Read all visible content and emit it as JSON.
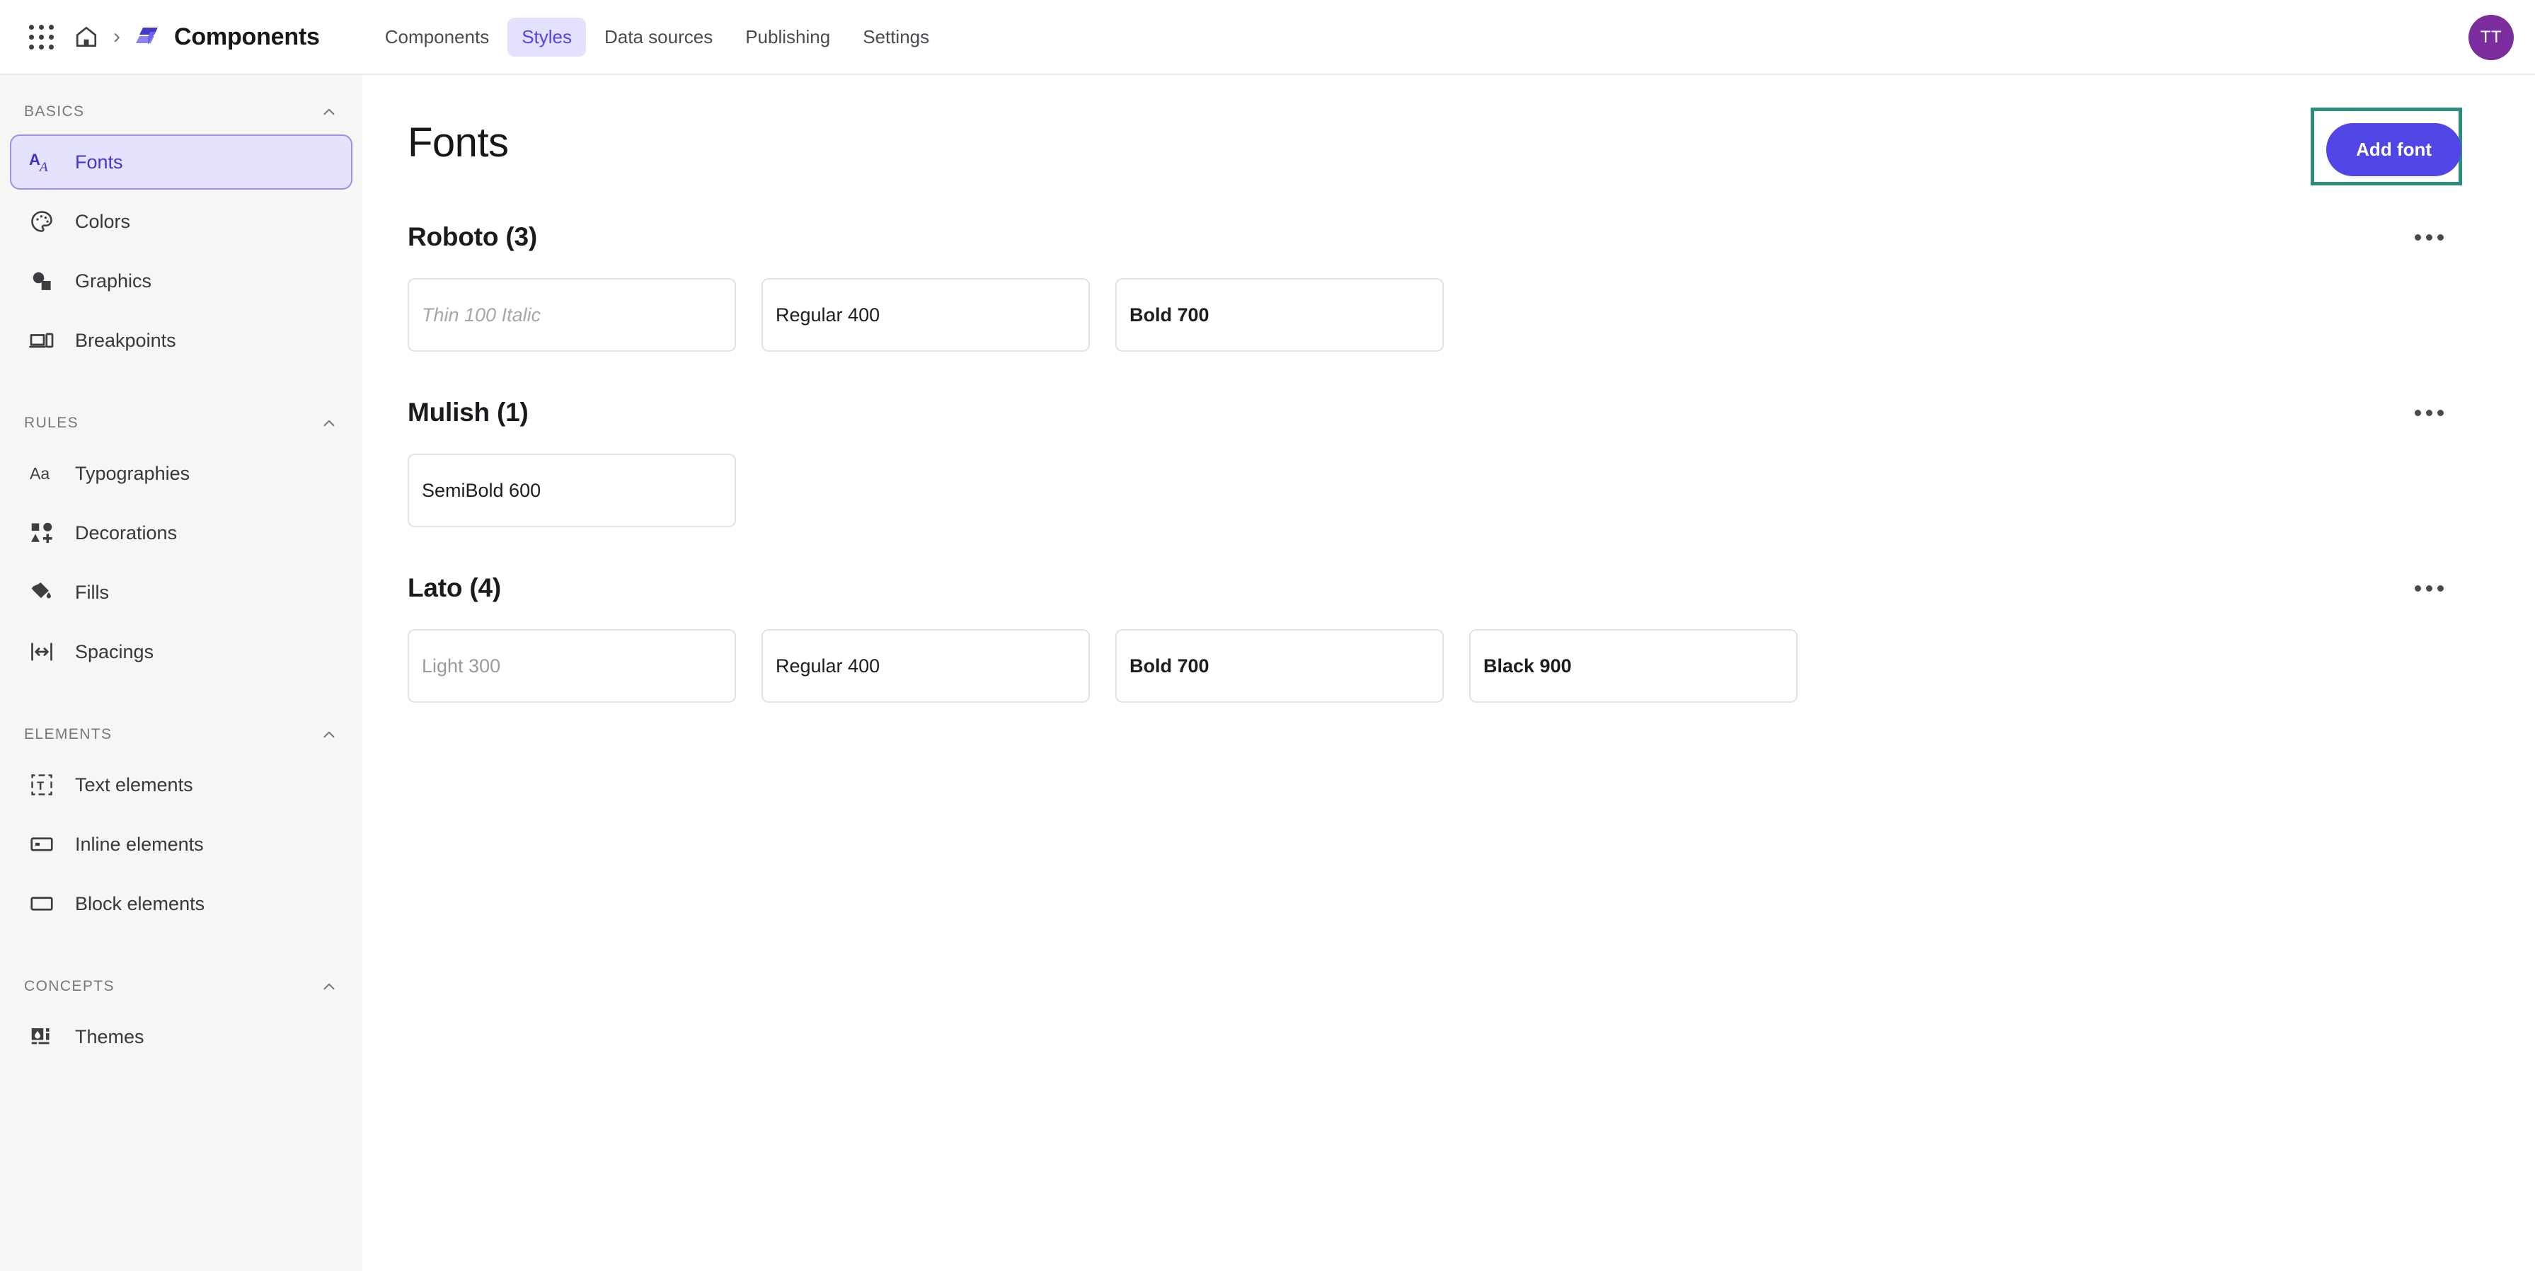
{
  "topbar": {
    "apps_icon": "grid-apps-icon",
    "home_icon": "home-icon",
    "separator": "›",
    "brand_logo_icon": "stacked-layers-logo-icon",
    "brand_name": "Components",
    "tabs": [
      {
        "label": "Components",
        "active": false
      },
      {
        "label": "Styles",
        "active": true
      },
      {
        "label": "Data sources",
        "active": false
      },
      {
        "label": "Publishing",
        "active": false
      },
      {
        "label": "Settings",
        "active": false
      }
    ],
    "avatar_initials": "TT",
    "avatar_color": "#7b2d9e"
  },
  "sidebar": {
    "groups": [
      {
        "title": "BASICS",
        "collapse_icon": "chevron-up-icon",
        "items": [
          {
            "label": "Fonts",
            "icon": "font-aa-icon",
            "active": true
          },
          {
            "label": "Colors",
            "icon": "palette-icon",
            "active": false
          },
          {
            "label": "Graphics",
            "icon": "shapes-icon",
            "active": false
          },
          {
            "label": "Breakpoints",
            "icon": "devices-icon",
            "active": false
          }
        ]
      },
      {
        "title": "RULES",
        "collapse_icon": "chevron-up-icon",
        "items": [
          {
            "label": "Typographies",
            "icon": "text-aa-icon",
            "active": false
          },
          {
            "label": "Decorations",
            "icon": "decorations-icon",
            "active": false
          },
          {
            "label": "Fills",
            "icon": "paint-bucket-icon",
            "active": false
          },
          {
            "label": "Spacings",
            "icon": "spacing-arrows-icon",
            "active": false
          }
        ]
      },
      {
        "title": "ELEMENTS",
        "collapse_icon": "chevron-up-icon",
        "items": [
          {
            "label": "Text elements",
            "icon": "text-box-icon",
            "active": false
          },
          {
            "label": "Inline elements",
            "icon": "inline-box-icon",
            "active": false
          },
          {
            "label": "Block elements",
            "icon": "block-box-icon",
            "active": false
          }
        ]
      },
      {
        "title": "CONCEPTS",
        "collapse_icon": "chevron-up-icon",
        "items": [
          {
            "label": "Themes",
            "icon": "theme-drop-icon",
            "active": false
          }
        ]
      }
    ]
  },
  "main": {
    "page_title": "Fonts",
    "add_font_label": "Add font",
    "add_font_accent": "#4f46e5",
    "focus_ring_color": "#2e8b80",
    "kebab_icon": "more-horizontal-icon",
    "sections": [
      {
        "title": "Roboto (3)",
        "family": "Roboto",
        "count": 3,
        "weights": [
          {
            "label": "Thin 100 Italic",
            "style": "thin-italic"
          },
          {
            "label": "Regular 400",
            "style": "regular"
          },
          {
            "label": "Bold 700",
            "style": "bold"
          }
        ]
      },
      {
        "title": "Mulish (1)",
        "family": "Mulish",
        "count": 1,
        "weights": [
          {
            "label": "SemiBold 600",
            "style": "semibold"
          }
        ]
      },
      {
        "title": "Lato (4)",
        "family": "Lato",
        "count": 4,
        "weights": [
          {
            "label": "Light 300",
            "style": "light"
          },
          {
            "label": "Regular 400",
            "style": "regular"
          },
          {
            "label": "Bold 700",
            "style": "bold"
          },
          {
            "label": "Black 900",
            "style": "black"
          }
        ]
      }
    ]
  }
}
